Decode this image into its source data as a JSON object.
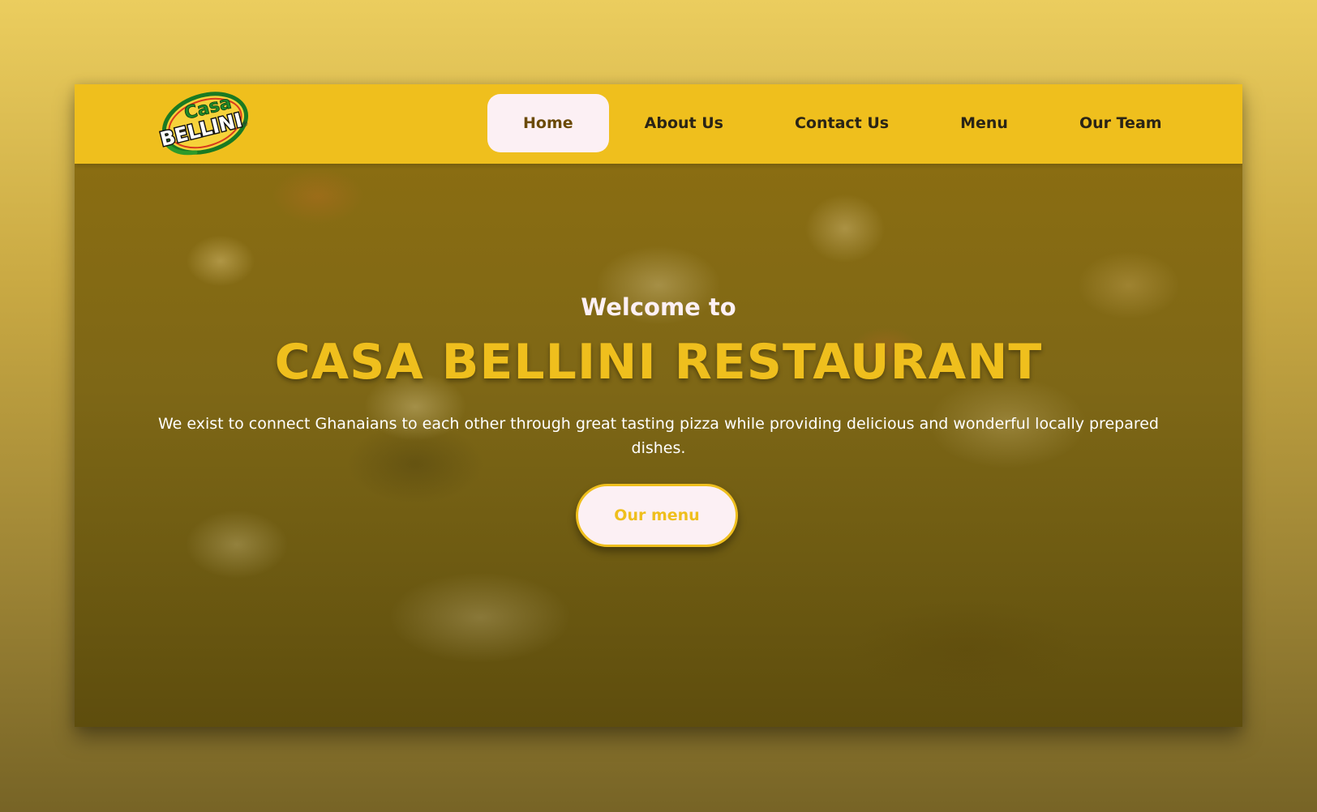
{
  "brand": {
    "logo_text_top": "Casa",
    "logo_text_bottom": "BELLINI",
    "logo_mark": "®"
  },
  "nav": {
    "items": [
      {
        "label": "Home",
        "active": true
      },
      {
        "label": "About Us",
        "active": false
      },
      {
        "label": "Contact Us",
        "active": false
      },
      {
        "label": "Menu",
        "active": false
      },
      {
        "label": "Our Team",
        "active": false
      }
    ]
  },
  "hero": {
    "welcome": "Welcome to",
    "title": "CASA BELLINI RESTAURANT",
    "description": "We exist to connect Ghanaians to each other through great tasting pizza while providing delicious and wonderful locally prepared dishes.",
    "cta_label": "Our menu"
  },
  "colors": {
    "accent": "#efbf1d",
    "light": "#fcf0f4",
    "nav_text": "#2a2416",
    "active_text": "#6b4a06"
  }
}
